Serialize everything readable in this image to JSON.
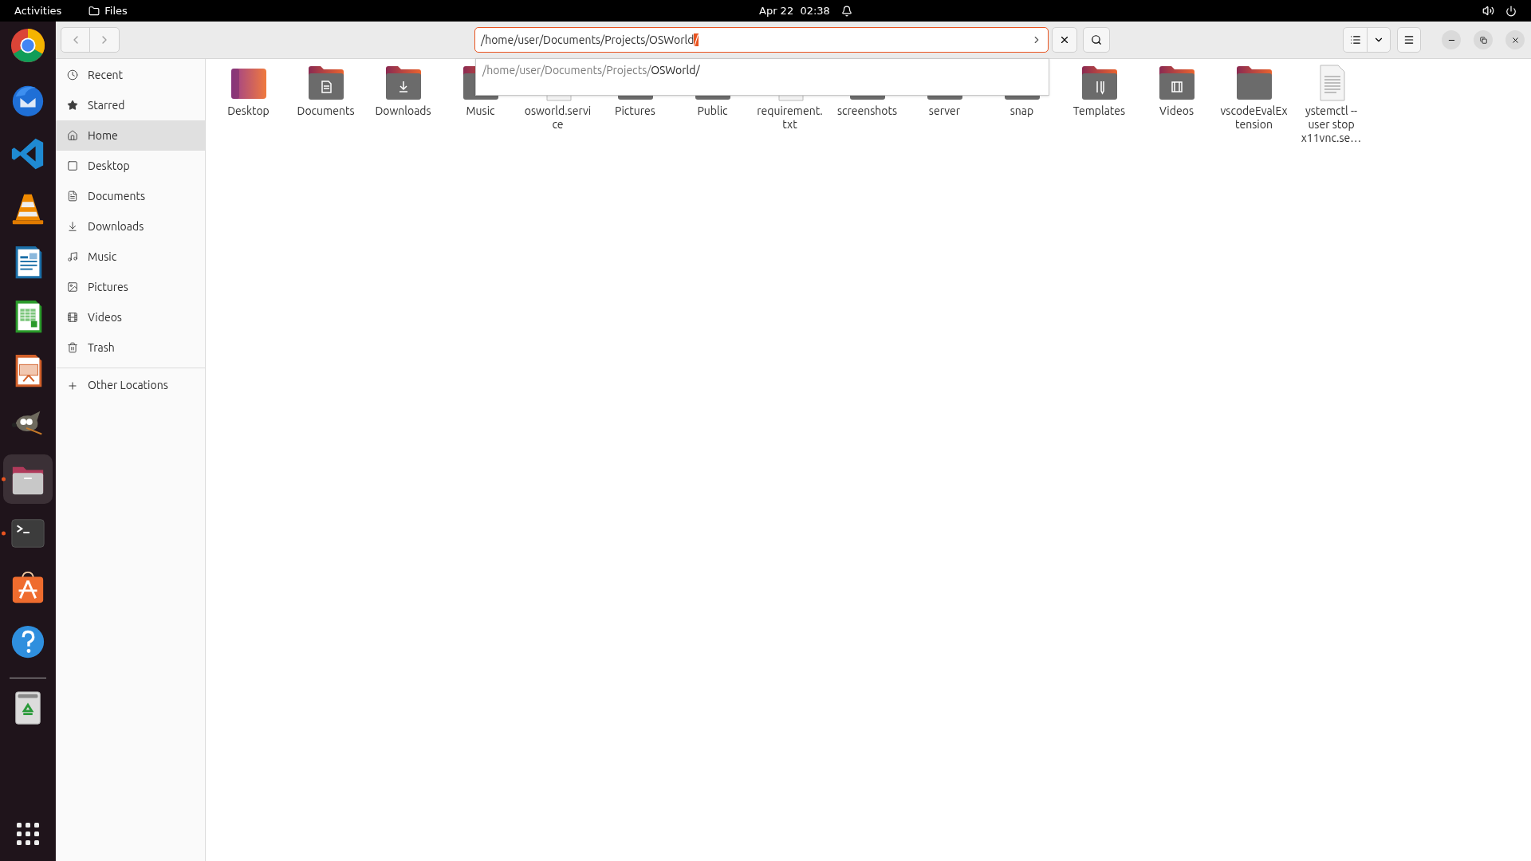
{
  "top_bar": {
    "activities": "Activities",
    "app_name": "Files",
    "clock": "Apr 22  02:38"
  },
  "dock": [
    {
      "kind": "chrome",
      "running": false,
      "selected": false
    },
    {
      "kind": "thunderbird",
      "running": false,
      "selected": false
    },
    {
      "kind": "vscode",
      "running": false,
      "selected": false
    },
    {
      "kind": "vlc",
      "running": false,
      "selected": false
    },
    {
      "kind": "writer",
      "running": false,
      "selected": false
    },
    {
      "kind": "calc",
      "running": false,
      "selected": false
    },
    {
      "kind": "impress",
      "running": false,
      "selected": false
    },
    {
      "kind": "gimp",
      "running": false,
      "selected": false
    },
    {
      "kind": "files",
      "running": true,
      "selected": true
    },
    {
      "kind": "terminal",
      "running": true,
      "selected": false
    },
    {
      "kind": "appcenter",
      "running": false,
      "selected": false
    },
    {
      "kind": "help",
      "running": false,
      "selected": false
    }
  ],
  "dock_extra": [
    {
      "kind": "trash"
    }
  ],
  "location_bar": {
    "value": "/home/user/Documents/Projects/OSWorld",
    "selected_text": "/"
  },
  "completion": {
    "base": "/home/user/Documents/Projects/",
    "match": "OSWorld/"
  },
  "sidebar": {
    "items": [
      {
        "label": "Recent",
        "kind": "recent",
        "selected": false
      },
      {
        "label": "Starred",
        "kind": "starred",
        "selected": false
      },
      {
        "label": "Home",
        "kind": "home",
        "selected": true
      },
      {
        "label": "Desktop",
        "kind": "desktop",
        "selected": false
      },
      {
        "label": "Documents",
        "kind": "documents",
        "selected": false
      },
      {
        "label": "Downloads",
        "kind": "downloads",
        "selected": false
      },
      {
        "label": "Music",
        "kind": "music",
        "selected": false
      },
      {
        "label": "Pictures",
        "kind": "pictures",
        "selected": false
      },
      {
        "label": "Videos",
        "kind": "videos",
        "selected": false
      },
      {
        "label": "Trash",
        "kind": "trash",
        "selected": false
      }
    ],
    "other": {
      "label": "Other Locations"
    }
  },
  "files": [
    {
      "name": "Desktop",
      "kind": "desktop"
    },
    {
      "name": "Documents",
      "kind": "documents"
    },
    {
      "name": "Downloads",
      "kind": "downloads"
    },
    {
      "name": "Music",
      "kind": "folder"
    },
    {
      "name": "osworld.service",
      "kind": "file"
    },
    {
      "name": "Pictures",
      "kind": "folder"
    },
    {
      "name": "Public",
      "kind": "folder"
    },
    {
      "name": "requirement.txt",
      "kind": "file"
    },
    {
      "name": "screenshots",
      "kind": "folder"
    },
    {
      "name": "server",
      "kind": "folder"
    },
    {
      "name": "snap",
      "kind": "folder"
    },
    {
      "name": "Templates",
      "kind": "templates"
    },
    {
      "name": "Videos",
      "kind": "videos"
    },
    {
      "name": "vscodeEvalExtension",
      "kind": "folder"
    },
    {
      "name": "ystemctl --user stop x11vnc.se…",
      "kind": "textfile"
    }
  ]
}
